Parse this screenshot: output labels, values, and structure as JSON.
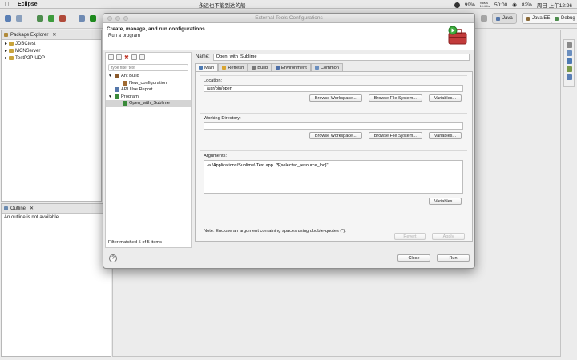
{
  "menubar": {
    "app_name": "Eclipse",
    "now_playing": "永远也不能到达的船",
    "battery_pct": "99%",
    "net_up": "9.8K/s",
    "net_down": "10.4K/s",
    "timer": "50:00",
    "battery2": "82%",
    "clock": "周日 上午12:26"
  },
  "eclipse": {
    "perspectives": [
      {
        "label": "Java",
        "active": true
      },
      {
        "label": "Java EE",
        "active": false
      },
      {
        "label": "Debug",
        "active": false
      }
    ],
    "package_explorer": {
      "tab_label": "Package Explorer",
      "projects": [
        "JDBCtest",
        "MCNServer",
        "TestP2P-UDP"
      ]
    },
    "outline": {
      "tab_label": "Outline",
      "message": "An outline is not available."
    }
  },
  "dialog": {
    "window_title": "External Tools Configurations",
    "heading": "Create, manage, and run configurations",
    "subheading": "Run a program",
    "filter_placeholder": "type filter text",
    "tree": [
      {
        "label": "Ant Build",
        "level": 0,
        "expander": "▾",
        "icon_color": "#8b5a2b",
        "selected": false
      },
      {
        "label": "New_configuration",
        "level": 1,
        "expander": "",
        "icon_color": "#a06a32",
        "selected": false
      },
      {
        "label": "API Use Report",
        "level": 0,
        "expander": "",
        "icon_color": "#5577aa",
        "selected": false
      },
      {
        "label": "Program",
        "level": 0,
        "expander": "▾",
        "icon_color": "#3b8a3b",
        "selected": false
      },
      {
        "label": "Open_with_Sublime",
        "level": 1,
        "expander": "",
        "icon_color": "#3b8a3b",
        "selected": true
      }
    ],
    "filter_status": "Filter matched 5 of 5 items",
    "name_label": "Name:",
    "name_value": "Open_with_Sublime",
    "tabs": [
      {
        "label": "Main",
        "active": true,
        "icon_color": "#4d7ab3"
      },
      {
        "label": "Refresh",
        "active": false,
        "icon_color": "#d9a531"
      },
      {
        "label": "Build",
        "active": false,
        "icon_color": "#777777"
      },
      {
        "label": "Environment",
        "active": false,
        "icon_color": "#4d6fa8"
      },
      {
        "label": "Common",
        "active": false,
        "icon_color": "#6b8fbf"
      }
    ],
    "location": {
      "label": "Location:",
      "value": "/usr/bin/open",
      "buttons": [
        "Browse Workspace...",
        "Browse File System...",
        "Variables..."
      ]
    },
    "working_directory": {
      "label": "Working Directory:",
      "value": "",
      "buttons": [
        "Browse Workspace...",
        "Browse File System...",
        "Variables..."
      ]
    },
    "arguments": {
      "label": "Arguments:",
      "value": "-a /Applications/Sublime\\ Text.app  \"${selected_resource_loc}\"",
      "variables_button": "Variables..."
    },
    "note": "Note: Enclose an argument containing spaces using double-quotes (\").",
    "revert_button": "Revert",
    "apply_button": "Apply",
    "close_button": "Close",
    "run_button": "Run",
    "help_glyph": "?"
  }
}
